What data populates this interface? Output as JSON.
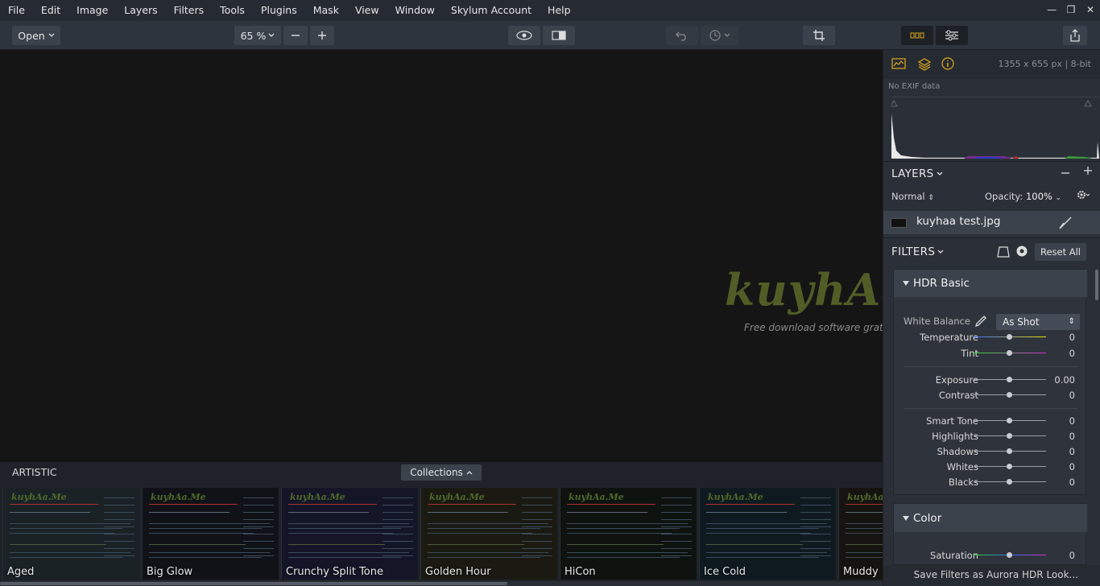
{
  "menu": [
    "File",
    "Edit",
    "Image",
    "Layers",
    "Filters",
    "Tools",
    "Plugins",
    "Mask",
    "View",
    "Window",
    "Skylum Account",
    "Help"
  ],
  "window_controls": {
    "minimize": "—",
    "restore": "❐",
    "close": "✕"
  },
  "toolbar": {
    "open_label": "Open",
    "zoom_label": "65 %",
    "zoom_out_icon": "minus-icon",
    "zoom_in_icon": "plus-icon"
  },
  "watermark": {
    "logo": "kuyhAa.Me",
    "tagline": "Free download software gratis"
  },
  "presets": {
    "category": "ARTISTIC",
    "collections_label": "Collections",
    "items": [
      "Aged",
      "Big Glow",
      "Crunchy Split Tone",
      "Golden Hour",
      "HiCon",
      "Ice Cold",
      "Muddy"
    ],
    "tints": [
      "#1a2226",
      "#101217",
      "#141628",
      "#1a1a12",
      "#0e1310",
      "#0f1a20",
      "#161410"
    ]
  },
  "panel": {
    "dimensions": "1355 x 655 px  |  8-bit",
    "exif": "No EXIF data",
    "layers_title": "LAYERS",
    "blend_mode": "Normal",
    "opacity_label": "Opacity:",
    "opacity_value": "100%",
    "layer_name": "kuyhaa test.jpg",
    "filters_title": "FILTERS",
    "reset_all": "Reset All",
    "hdr_basic": {
      "title": "HDR Basic",
      "white_balance_label": "White Balance",
      "white_balance_value": "As Shot",
      "temperature": {
        "label": "Temperature",
        "value": "0"
      },
      "tint": {
        "label": "Tint",
        "value": "0"
      },
      "exposure": {
        "label": "Exposure",
        "value": "0.00"
      },
      "contrast": {
        "label": "Contrast",
        "value": "0"
      },
      "smart_tone": {
        "label": "Smart Tone",
        "value": "0"
      },
      "highlights": {
        "label": "Highlights",
        "value": "0"
      },
      "shadows": {
        "label": "Shadows",
        "value": "0"
      },
      "whites": {
        "label": "Whites",
        "value": "0"
      },
      "blacks": {
        "label": "Blacks",
        "value": "0"
      }
    },
    "color": {
      "title": "Color",
      "saturation": {
        "label": "Saturation",
        "value": "0"
      }
    },
    "save_filters": "Save Filters as Aurora HDR Look..."
  },
  "colors": {
    "accent": "#e0a81e",
    "panel": "#2b3038",
    "toolbar": "#2e343d"
  }
}
